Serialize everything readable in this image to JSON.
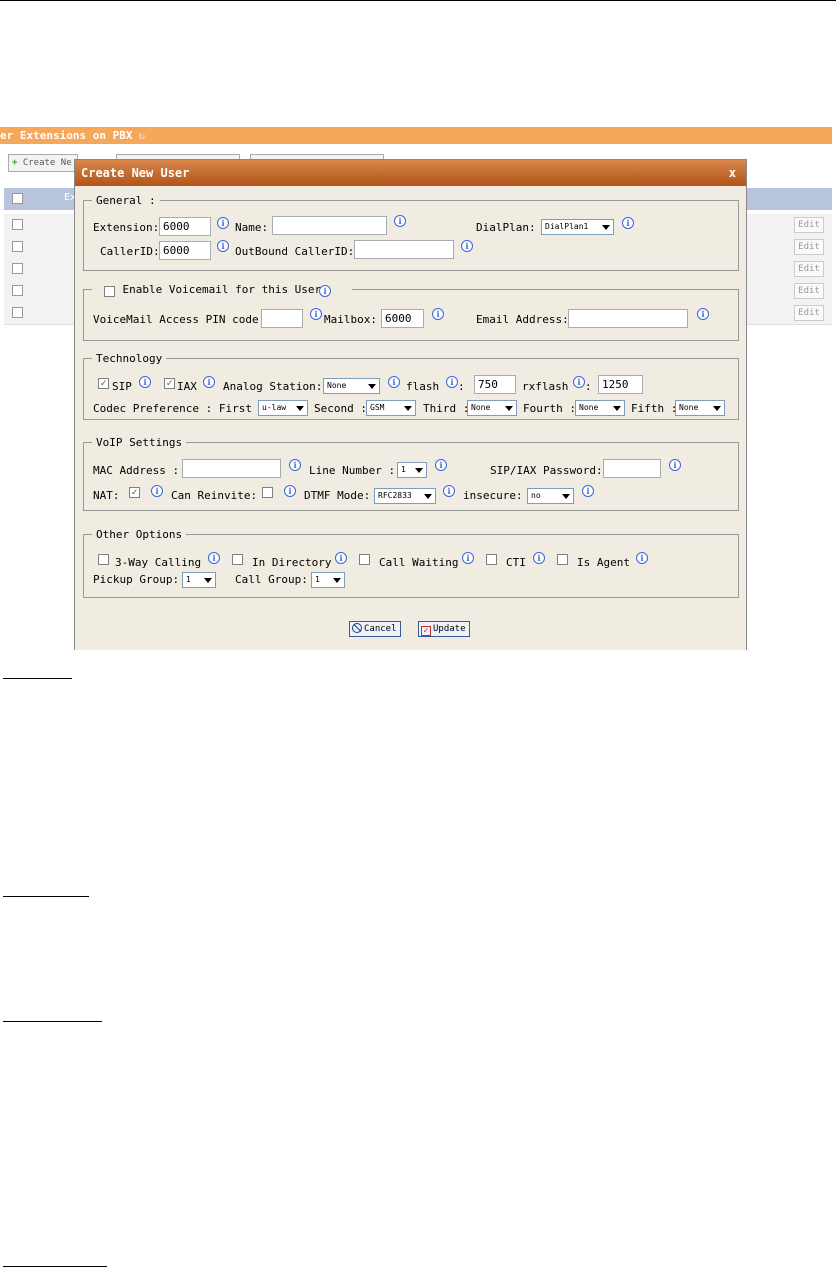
{
  "background": {
    "title": "er Extensions on PBX",
    "refresh_icon": "↻",
    "create_button": "Create Ne",
    "header_col": "Ex",
    "edit_label": "Edit",
    "rows": [
      "Edit",
      "Edit",
      "Edit",
      "Edit",
      "Edit"
    ]
  },
  "dialog": {
    "title": "Create New User",
    "close": "x",
    "general": {
      "legend": "General :",
      "extension_label": "Extension:",
      "extension_value": "6000",
      "name_label": "Name:",
      "name_value": "",
      "dialplan_label": "DialPlan:",
      "dialplan_value": "DialPlan1",
      "callerid_label": "CallerID:",
      "callerid_value": "6000",
      "outbound_label": "OutBound CallerID:",
      "outbound_value": ""
    },
    "voicemail": {
      "legend": "Enable Voicemail for this User",
      "pin_label": "VoiceMail Access PIN code:",
      "pin_value": "",
      "mailbox_label": "Mailbox:",
      "mailbox_value": "6000",
      "email_label": "Email Address:",
      "email_value": ""
    },
    "technology": {
      "legend": "Technology",
      "sip_label": "SIP",
      "iax_label": "IAX",
      "analog_label": "Analog Station:",
      "analog_value": "None",
      "flash_label": "flash",
      "flash_colon": ":",
      "flash_value": "750",
      "rxflash_label": "rxflash",
      "rxflash_colon": ":",
      "rxflash_value": "1250",
      "codec_label": "Codec Preference : First :",
      "first_value": "u-law",
      "second_label": "Second :",
      "second_value": "GSM",
      "third_label": "Third :",
      "third_value": "None",
      "fourth_label": "Fourth :",
      "fourth_value": "None",
      "fifth_label": "Fifth :",
      "fifth_value": "None"
    },
    "voip": {
      "legend": "VoIP Settings",
      "mac_label": "MAC Address :",
      "mac_value": "",
      "line_label": "Line Number :",
      "line_value": "1",
      "password_label": "SIP/IAX Password:",
      "password_value": "",
      "nat_label": "NAT:",
      "reinvite_label": "Can Reinvite:",
      "dtmf_label": "DTMF Mode:",
      "dtmf_value": "RFC2833",
      "insecure_label": "insecure:",
      "insecure_value": "no"
    },
    "other": {
      "legend": "Other Options",
      "threeway_label": "3-Way Calling",
      "directory_label": "In Directory",
      "waiting_label": "Call Waiting",
      "cti_label": "CTI",
      "agent_label": "Is Agent",
      "pickup_label": "Pickup Group:",
      "pickup_value": "1",
      "callgroup_label": "Call Group:",
      "callgroup_value": "1"
    },
    "buttons": {
      "cancel": "Cancel",
      "update": "Update"
    }
  },
  "icons": {
    "info": "i",
    "check": "✓"
  }
}
